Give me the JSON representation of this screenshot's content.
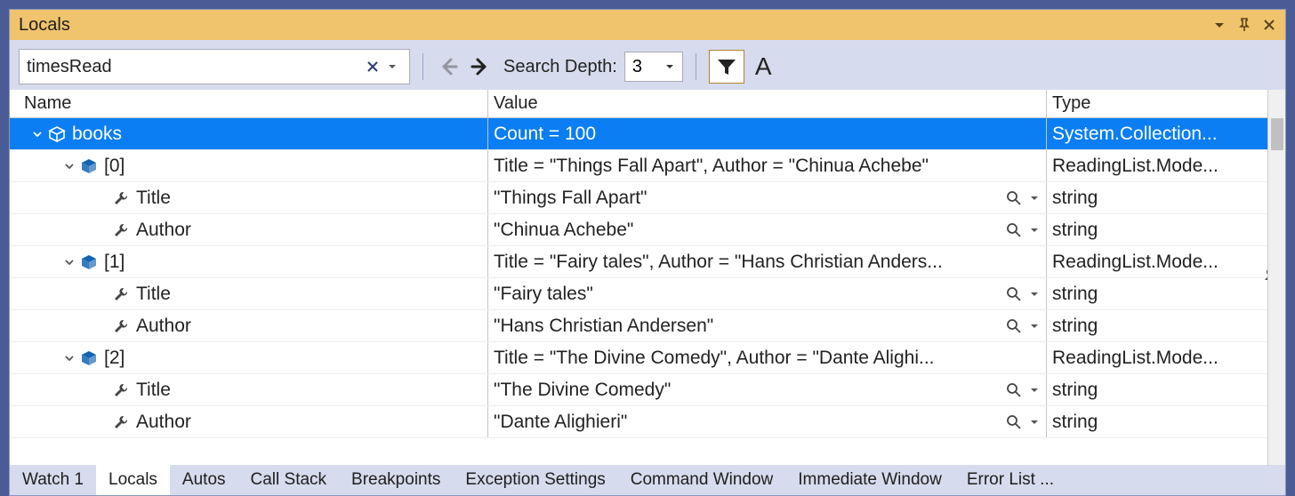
{
  "panel": {
    "title": "Locals"
  },
  "search": {
    "value": "timesRead",
    "depth_label": "Search Depth:",
    "depth_value": "3"
  },
  "grid": {
    "headers": {
      "name": "Name",
      "value": "Value",
      "type": "Type"
    },
    "rows": [
      {
        "indent": 0,
        "expander": "down",
        "icon": "cube-outline",
        "selected": true,
        "name": "books",
        "value": "Count = 100",
        "type": "System.Collection...",
        "pin": false,
        "vis": false
      },
      {
        "indent": 1,
        "expander": "down",
        "icon": "cube",
        "selected": false,
        "name": "[0]",
        "value": "Title = \"Things Fall Apart\", Author = \"Chinua Achebe\"",
        "type": "ReadingList.Mode...",
        "pin": false,
        "vis": false
      },
      {
        "indent": 2,
        "expander": "none",
        "icon": "wrench",
        "selected": false,
        "name": "Title",
        "value": "\"Things Fall Apart\"",
        "type": "string",
        "pin": true,
        "vis": true
      },
      {
        "indent": 2,
        "expander": "none",
        "icon": "wrench",
        "selected": false,
        "name": "Author",
        "value": "\"Chinua Achebe\"",
        "type": "string",
        "pin": true,
        "vis": true
      },
      {
        "indent": 1,
        "expander": "down",
        "icon": "cube",
        "selected": false,
        "name": "[1]",
        "value": "Title = \"Fairy tales\", Author = \"Hans Christian Anders...",
        "type": "ReadingList.Mode...",
        "pin": false,
        "vis": false
      },
      {
        "indent": 2,
        "expander": "none",
        "icon": "wrench",
        "selected": false,
        "name": "Title",
        "value": "\"Fairy tales\"",
        "type": "string",
        "pin": true,
        "vis": true
      },
      {
        "indent": 2,
        "expander": "none",
        "icon": "wrench",
        "selected": false,
        "name": "Author",
        "value": "\"Hans Christian Andersen\"",
        "type": "string",
        "pin": true,
        "vis": true
      },
      {
        "indent": 1,
        "expander": "down",
        "icon": "cube",
        "selected": false,
        "name": "[2]",
        "value": "Title = \"The Divine Comedy\", Author = \"Dante Alighi...",
        "type": "ReadingList.Mode...",
        "pin": false,
        "vis": false
      },
      {
        "indent": 2,
        "expander": "none",
        "icon": "wrench",
        "selected": false,
        "name": "Title",
        "value": "\"The Divine Comedy\"",
        "type": "string",
        "pin": true,
        "vis": true
      },
      {
        "indent": 2,
        "expander": "none",
        "icon": "wrench",
        "selected": false,
        "name": "Author",
        "value": "\"Dante Alighieri\"",
        "type": "string",
        "pin": true,
        "vis": true
      }
    ]
  },
  "tabs": [
    {
      "label": "Watch 1",
      "active": false
    },
    {
      "label": "Locals",
      "active": true
    },
    {
      "label": "Autos",
      "active": false
    },
    {
      "label": "Call Stack",
      "active": false
    },
    {
      "label": "Breakpoints",
      "active": false
    },
    {
      "label": "Exception Settings",
      "active": false
    },
    {
      "label": "Command Window",
      "active": false
    },
    {
      "label": "Immediate Window",
      "active": false
    },
    {
      "label": "Error List ...",
      "active": false
    }
  ]
}
